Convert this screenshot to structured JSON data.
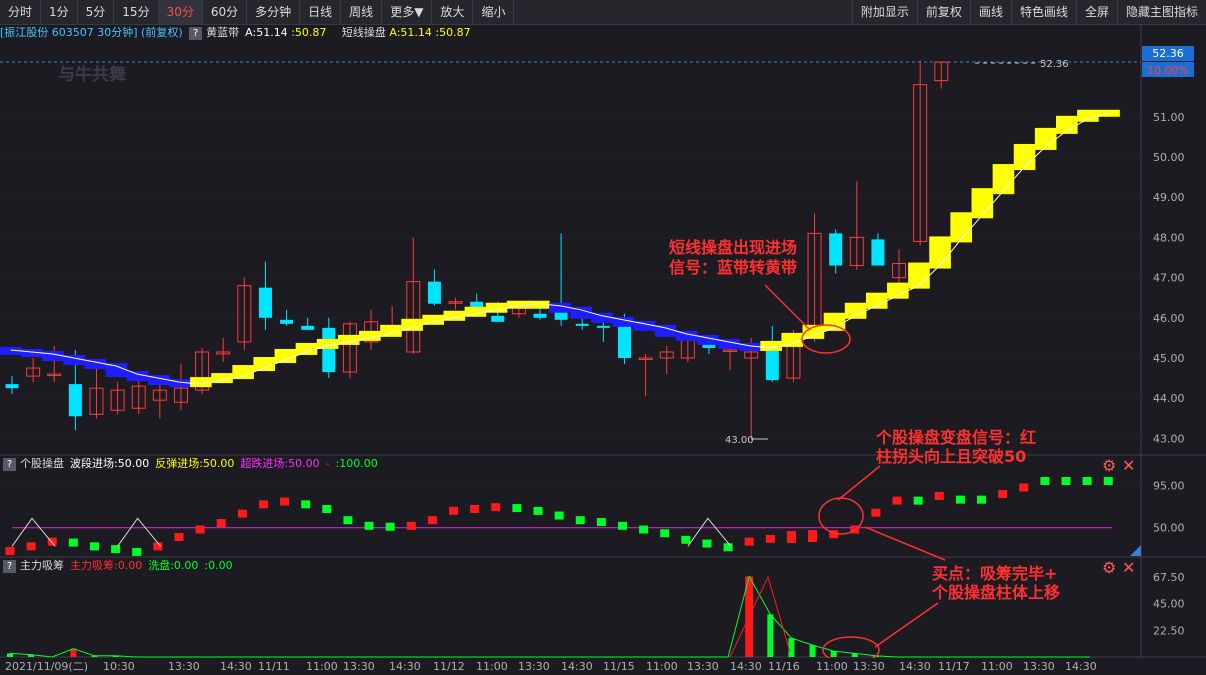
{
  "toolbar": {
    "left": [
      "分时",
      "1分",
      "5分",
      "15分",
      "30分",
      "60分",
      "多分钟",
      "日线",
      "周线",
      "更多▼",
      "放大",
      "缩小"
    ],
    "active": "30分",
    "right": [
      "附加显示",
      "前复权",
      "画线",
      "特色画线",
      "全屏",
      "隐藏主图指标"
    ]
  },
  "header": {
    "stock": "[振江股份 603507 30分钟] (前复权)",
    "ind1_name": "黄蓝带",
    "ind1_a": "A:51.14",
    "ind1_b": ":50.87",
    "ind2_name": "短线操盘",
    "ind2_a": "A:51.14",
    "ind2_b": ":50.87"
  },
  "watermark": "与牛共舞",
  "price_axis": {
    "ticks": [
      "52.36",
      "51.00",
      "50.00",
      "49.00",
      "48.00",
      "47.00",
      "46.00",
      "45.00",
      "44.00",
      "43.00"
    ],
    "current_price": "52.36",
    "current_change": "10.00%",
    "high_label": "52.36",
    "low_label": "43.00"
  },
  "candles": [
    [
      44.35,
      44.55,
      44.1,
      44.25
    ],
    [
      44.55,
      45.0,
      44.4,
      44.75
    ],
    [
      44.6,
      45.3,
      44.4,
      44.6
    ],
    [
      44.35,
      45.2,
      43.2,
      43.55
    ],
    [
      43.6,
      44.85,
      43.5,
      44.25
    ],
    [
      43.7,
      44.4,
      43.6,
      44.2
    ],
    [
      43.75,
      44.45,
      43.6,
      44.3
    ],
    [
      43.95,
      44.5,
      43.5,
      44.2
    ],
    [
      43.9,
      44.85,
      43.7,
      44.25
    ],
    [
      44.2,
      45.25,
      44.1,
      45.15
    ],
    [
      45.1,
      45.5,
      44.9,
      45.15
    ],
    [
      45.4,
      47.0,
      45.2,
      46.8
    ],
    [
      46.75,
      47.4,
      45.7,
      46.0
    ],
    [
      45.95,
      46.2,
      45.8,
      45.85
    ],
    [
      45.8,
      46.0,
      45.7,
      45.7
    ],
    [
      45.75,
      46.0,
      44.5,
      44.65
    ],
    [
      44.65,
      45.9,
      44.5,
      45.85
    ],
    [
      45.4,
      46.2,
      45.2,
      45.9
    ],
    [
      45.75,
      46.3,
      45.6,
      45.8
    ],
    [
      45.15,
      48.0,
      45.1,
      46.9
    ],
    [
      46.9,
      47.2,
      46.3,
      46.35
    ],
    [
      46.4,
      46.5,
      46.2,
      46.4
    ],
    [
      46.4,
      46.6,
      46.1,
      46.2
    ],
    [
      46.05,
      46.4,
      45.9,
      45.9
    ],
    [
      46.1,
      46.4,
      46.0,
      46.25
    ],
    [
      46.1,
      46.35,
      45.95,
      46.0
    ],
    [
      46.2,
      48.1,
      45.8,
      45.95
    ],
    [
      45.85,
      46.2,
      45.7,
      45.8
    ],
    [
      45.8,
      46.1,
      45.4,
      45.75
    ],
    [
      45.85,
      46.1,
      44.85,
      45.0
    ],
    [
      45.0,
      45.1,
      44.05,
      45.0
    ],
    [
      45.0,
      45.3,
      44.6,
      45.15
    ],
    [
      45.0,
      45.6,
      44.9,
      45.5
    ],
    [
      45.4,
      45.5,
      45.1,
      45.25
    ],
    [
      45.2,
      45.4,
      44.7,
      45.2
    ],
    [
      45.0,
      45.5,
      43.0,
      45.15
    ],
    [
      45.3,
      45.8,
      44.4,
      44.45
    ],
    [
      44.5,
      45.7,
      44.4,
      45.6
    ],
    [
      45.6,
      48.6,
      45.4,
      48.1
    ],
    [
      48.1,
      48.2,
      47.1,
      47.3
    ],
    [
      47.3,
      49.4,
      47.2,
      48.0
    ],
    [
      47.95,
      48.1,
      47.3,
      47.3
    ],
    [
      47.0,
      47.7,
      46.8,
      47.35
    ],
    [
      47.9,
      52.4,
      47.8,
      51.8
    ],
    [
      51.9,
      52.36,
      51.7,
      52.36
    ]
  ],
  "band_values": [
    45.2,
    45.15,
    45.1,
    45.0,
    44.9,
    44.8,
    44.6,
    44.5,
    44.4,
    44.35,
    44.45,
    44.55,
    44.75,
    44.95,
    45.15,
    45.3,
    45.4,
    45.5,
    45.6,
    45.75,
    45.9,
    46.0,
    46.1,
    46.2,
    46.3,
    46.35,
    46.3,
    46.2,
    46.05,
    45.95,
    45.85,
    45.75,
    45.6,
    45.5,
    45.4,
    45.3,
    45.25,
    45.35,
    45.55,
    45.75,
    46.05,
    46.3,
    46.55,
    46.8,
    47.3,
    47.95,
    48.55,
    49.15,
    49.75,
    50.25,
    50.65,
    50.95,
    51.1
  ],
  "band_dirs": [
    "B",
    "B",
    "B",
    "B",
    "B",
    "B",
    "B",
    "B",
    "B",
    "Y",
    "Y",
    "Y",
    "Y",
    "Y",
    "Y",
    "Y",
    "Y",
    "Y",
    "Y",
    "Y",
    "Y",
    "Y",
    "Y",
    "Y",
    "Y",
    "Y",
    "B",
    "B",
    "B",
    "B",
    "B",
    "B",
    "B",
    "B",
    "B",
    "B",
    "Y",
    "Y",
    "Y",
    "Y",
    "Y",
    "Y",
    "Y",
    "Y",
    "Y",
    "Y",
    "Y",
    "Y",
    "Y",
    "Y",
    "Y",
    "Y",
    "Y"
  ],
  "annotations": {
    "a1_line1": "短线操盘出现进场",
    "a1_line2": "信号：蓝带转黄带",
    "a2_line1": "个股操盘变盘信号：红",
    "a2_line2": "柱拐头向上且突破50",
    "a3_line1": "买点：吸筹完毕+",
    "a3_line2": "个股操盘柱体上移"
  },
  "panel2": {
    "name": "个股操盘",
    "s1": "波段进场:50.00",
    "s2": "反弹进场:50.00",
    "s3": "超跌进场:50.00",
    "s4": "-",
    "s5": ":100.00",
    "axis": [
      "95.00",
      "50.00"
    ],
    "values": [
      25,
      30,
      35,
      34,
      30,
      27,
      24,
      30,
      40,
      48,
      55,
      65,
      75,
      78,
      75,
      70,
      58,
      52,
      51,
      52,
      58,
      68,
      70,
      72,
      71,
      68,
      63,
      58,
      56,
      52,
      48,
      44,
      37,
      33,
      29,
      35,
      38,
      40,
      41,
      43,
      48,
      66,
      79,
      79,
      84,
      80,
      80,
      86,
      93,
      100,
      100,
      100,
      100
    ],
    "colors": [
      "R",
      "R",
      "R",
      "G",
      "G",
      "G",
      "G",
      "R",
      "R",
      "R",
      "R",
      "R",
      "R",
      "R",
      "G",
      "G",
      "G",
      "G",
      "G",
      "R",
      "R",
      "R",
      "R",
      "R",
      "G",
      "G",
      "G",
      "G",
      "G",
      "G",
      "G",
      "G",
      "G",
      "G",
      "G",
      "R",
      "R",
      "R",
      "R",
      "R",
      "R",
      "R",
      "R",
      "G",
      "R",
      "G",
      "G",
      "R",
      "R",
      "G",
      "G",
      "G",
      "G"
    ],
    "trough_starts": [
      0,
      5,
      32
    ]
  },
  "panel3": {
    "name": "主力吸筹",
    "s1": "主力吸筹:0.00",
    "s2": "洗盘:0.00",
    "s3": ":0.00",
    "axis": [
      "67.50",
      "45.00",
      "22.50"
    ],
    "values": [
      3,
      2,
      0,
      7,
      1,
      1,
      0,
      0,
      0,
      0,
      0,
      0,
      0,
      0,
      0,
      0,
      0,
      0,
      0,
      0,
      0,
      0,
      0,
      0,
      0,
      0,
      0,
      0,
      0,
      0,
      0,
      0,
      0,
      0,
      0,
      68,
      36,
      16,
      10,
      5,
      3,
      1,
      0
    ],
    "colors": [
      "G",
      "G",
      "G",
      "R",
      "G",
      "G",
      "G",
      "G",
      "G",
      "G",
      "G",
      "G",
      "G",
      "G",
      "G",
      "G",
      "G",
      "G",
      "G",
      "G",
      "G",
      "G",
      "G",
      "G",
      "G",
      "G",
      "G",
      "G",
      "G",
      "G",
      "G",
      "G",
      "G",
      "G",
      "G",
      "R",
      "G",
      "G",
      "G",
      "G",
      "G",
      "G",
      "G"
    ]
  },
  "time_axis": [
    "2021/11/09(二)",
    "10:30",
    "13:30",
    "14:30",
    "11/11",
    "11:00",
    "13:30",
    "14:30",
    "11/12",
    "11:00",
    "13:30",
    "14:30",
    "11/15",
    "11:00",
    "13:30",
    "14:30",
    "11/16",
    "11:00",
    "13:30",
    "14:30",
    "11/17",
    "11:00",
    "13:30",
    "14:30"
  ],
  "colors": {
    "up": "#ff3b3b",
    "down": "#00e5ff",
    "yellow": "#ffff00",
    "blue": "#1e1eff",
    "grid": "#2e2e38",
    "magenta": "#d020d0",
    "anno": "#ff3030",
    "green": "#00ff2a",
    "red": "#ff1a1a"
  }
}
